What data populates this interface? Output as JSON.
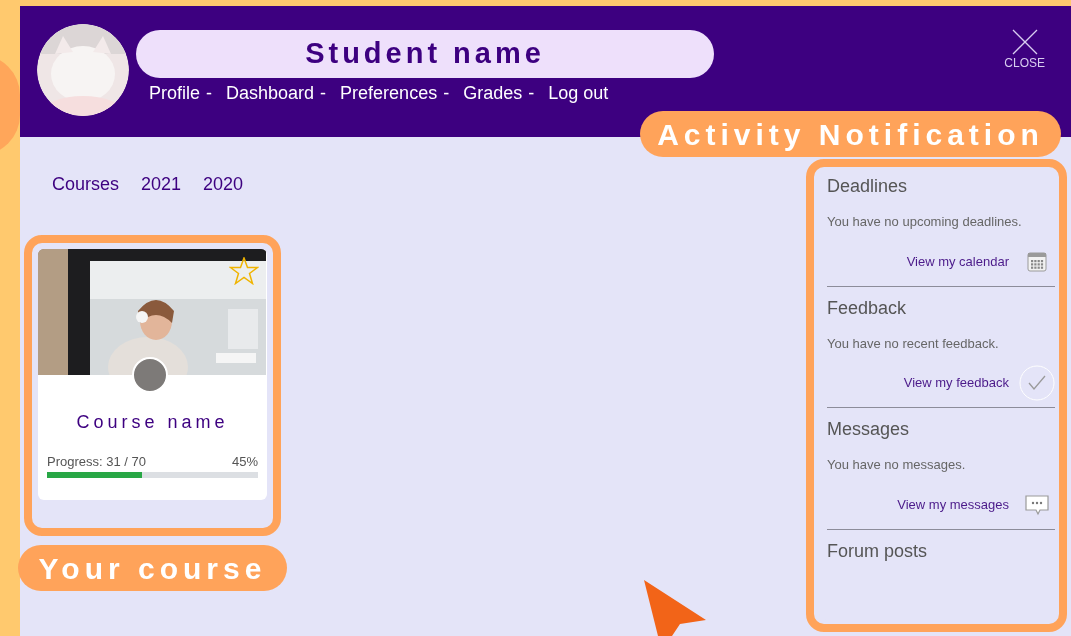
{
  "header": {
    "student_name": "Student name",
    "nav": [
      {
        "label": "Profile",
        "separator": "-"
      },
      {
        "label": "Dashboard",
        "separator": "-"
      },
      {
        "label": "Preferences",
        "separator": "-"
      },
      {
        "label": "Grades",
        "separator": "-"
      },
      {
        "label": "Log out"
      }
    ],
    "close_label": "CLOSE"
  },
  "annotations": {
    "activity": "Activity Notification",
    "course": "Your course"
  },
  "tabs": [
    {
      "label": "Courses"
    },
    {
      "label": "2021"
    },
    {
      "label": "2020"
    }
  ],
  "course_card": {
    "name": "Course name",
    "progress_label": "Progress: 31 / 70",
    "percent": "45%",
    "level": 0.45
  },
  "activity": [
    {
      "title": "Deadlines",
      "message": "You have no upcoming deadlines.",
      "link": "View my calendar",
      "kind": "calendar"
    },
    {
      "title": "Feedback",
      "message": "You have no recent feedback.",
      "link": "View my feedback",
      "kind": "check"
    },
    {
      "title": "Messages",
      "message": "You have no messages.",
      "link": "View my messages",
      "kind": "chat"
    },
    {
      "title": "Forum posts"
    }
  ]
}
